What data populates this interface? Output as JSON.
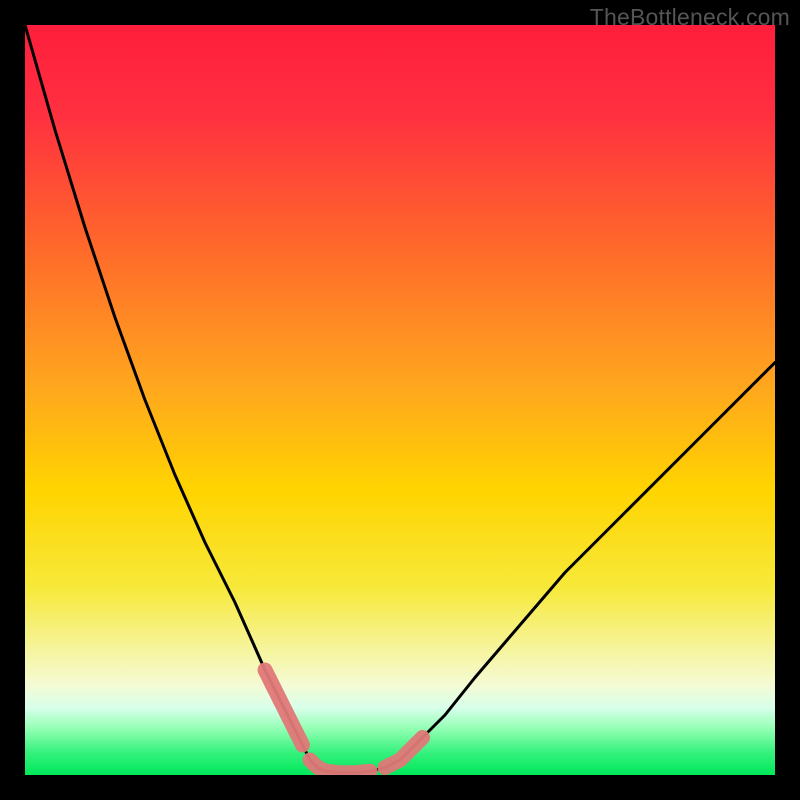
{
  "watermark": "TheBottleneck.com",
  "colors": {
    "background": "#000000",
    "top_hot": "#ff1e3c",
    "mid": "#ffd400",
    "green": "#00e85a",
    "curve": "#000000",
    "marker": "#e07878"
  },
  "chart_data": {
    "type": "line",
    "title": "",
    "xlabel": "",
    "ylabel": "",
    "xlim": [
      0,
      100
    ],
    "ylim": [
      0,
      100
    ],
    "grid": false,
    "legend": null,
    "annotations": [],
    "series": [
      {
        "name": "bottleneck-curve",
        "x": [
          0,
          4,
          8,
          12,
          16,
          20,
          24,
          28,
          32,
          34,
          36,
          37,
          38,
          39,
          40,
          42,
          44,
          46,
          48,
          50,
          52,
          56,
          60,
          66,
          72,
          80,
          90,
          100
        ],
        "values": [
          100,
          86,
          73,
          61,
          50,
          40,
          31,
          23,
          14,
          10,
          6,
          4,
          2,
          1,
          0.5,
          0.3,
          0.3,
          0.5,
          1,
          2,
          4,
          8,
          13,
          20,
          27,
          35,
          45,
          55
        ]
      }
    ],
    "marker_segments": [
      {
        "x_range": [
          32,
          37
        ],
        "y_range": [
          14,
          4
        ]
      },
      {
        "x_range": [
          38,
          46
        ],
        "y_range": [
          2,
          0.3
        ]
      },
      {
        "x_range": [
          48,
          53
        ],
        "y_range": [
          1,
          5
        ]
      }
    ],
    "notes": "Values estimated from pixel positions; axes have no visible tick labels so 0–100 normalized axes are assumed. Curve minimum is roughly at x≈42–44."
  }
}
